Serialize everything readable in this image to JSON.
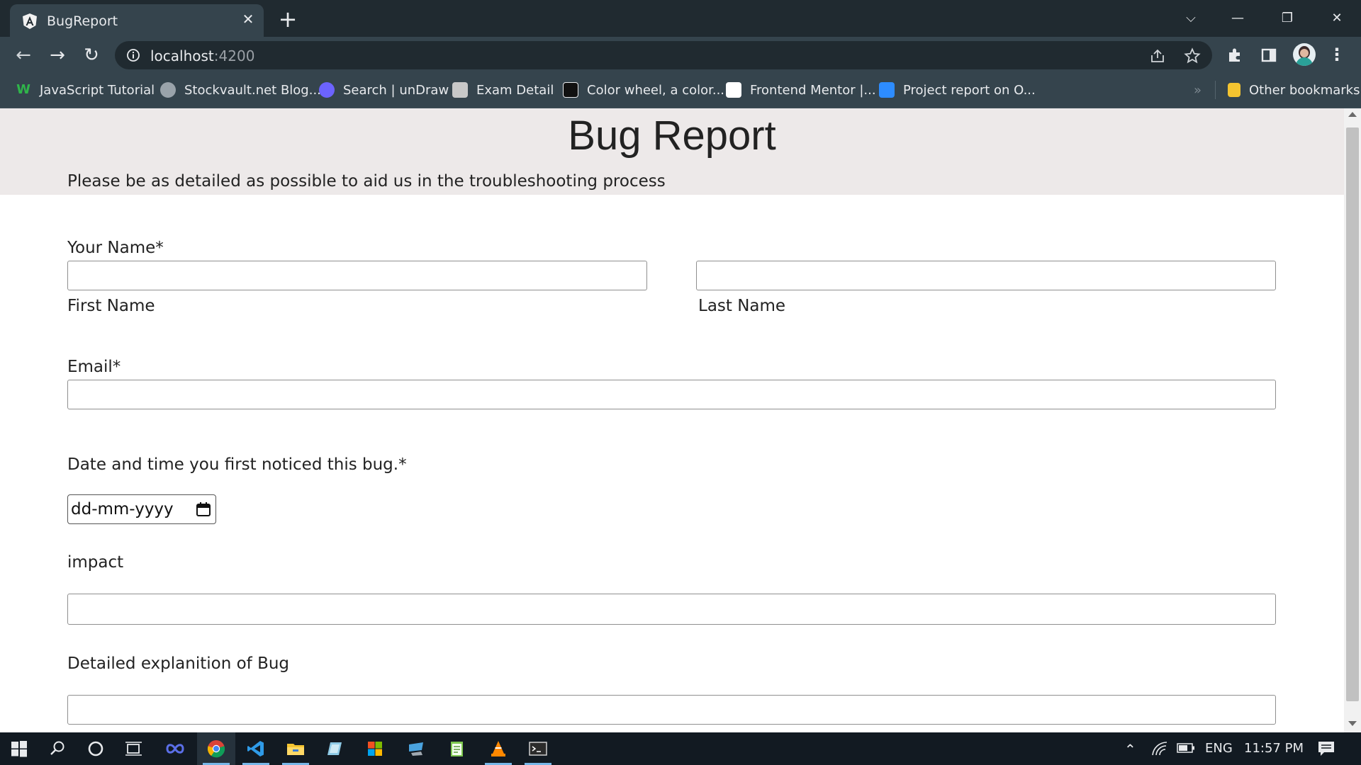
{
  "browser": {
    "tab": {
      "title": "BugReport",
      "close": "✕"
    },
    "new_tab": "+",
    "window_controls": {
      "dropdown": "⌵",
      "minimize": "—",
      "restore": "❐",
      "close": "✕"
    },
    "nav": {
      "back": "←",
      "forward": "→",
      "reload": "↻"
    },
    "url": {
      "host": "localhost",
      "port": ":4200"
    },
    "toolbar_icons": [
      "share-icon",
      "star-icon",
      "extensions-icon",
      "sidepanel-icon",
      "avatar",
      "menu-icon"
    ],
    "bookmarks": [
      {
        "label": "JavaScript Tutorial",
        "icon_color": "#2fb54a"
      },
      {
        "label": "Stockvault.net Blog...",
        "icon_color": "#9aa3aa"
      },
      {
        "label": "Search | unDraw",
        "icon_color": "#6c63ff"
      },
      {
        "label": "Exam Detail",
        "icon_color": "#c8c8c8"
      },
      {
        "label": "Color wheel, a color...",
        "icon_color": "#111111"
      },
      {
        "label": "Frontend Mentor |...",
        "icon_color": "#ffffff"
      },
      {
        "label": "Project report on O...",
        "icon_color": "#2d8cff"
      }
    ],
    "bookmarks_overflow": "»",
    "other_bookmarks": "Other bookmarks"
  },
  "page": {
    "title": "Bug Report",
    "subtitle": "Please be as detailed as possible to aid us in the troubleshooting process",
    "name_label": "Your Name*",
    "first_name_label": "First Name",
    "last_name_label": "Last Name",
    "email_label": "Email*",
    "date_label": "Date and time you first noticed this bug.*",
    "date_placeholder": "dd-mm-yyyy",
    "impact_label": "impact",
    "detail_label": "Detailed explanition of Bug"
  },
  "taskbar": {
    "apps": [
      "windows-start-icon",
      "search-icon",
      "cortana-icon",
      "task-view-icon",
      "infinity-app-icon",
      "chrome-icon",
      "vscode-icon",
      "file-explorer-icon",
      "app-icon",
      "store-icon",
      "app-icon-2",
      "notepad-icon",
      "vlc-icon",
      "terminal-icon"
    ],
    "language": "ENG",
    "time": "11:57 PM"
  },
  "colors": {
    "tab_strip": "#202a30",
    "toolbar": "#35444d",
    "header_band": "#ede9e9",
    "taskbar": "#121a22"
  }
}
